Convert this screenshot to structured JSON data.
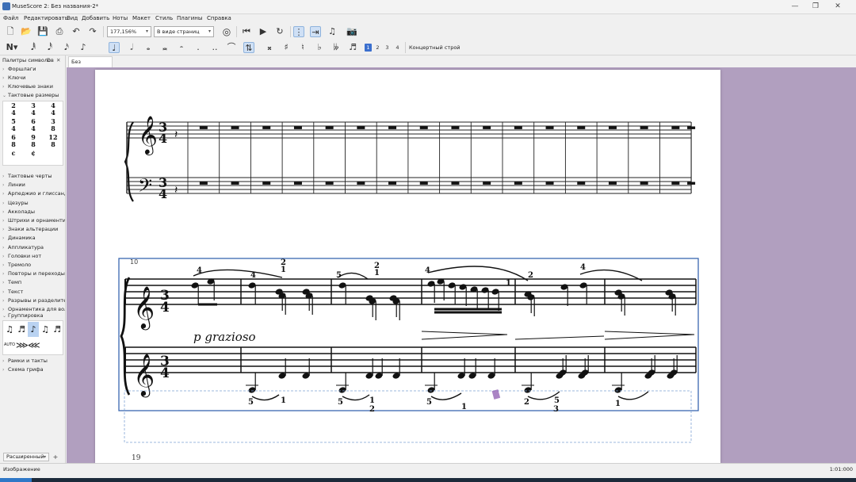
{
  "window": {
    "title": "MuseScore 2: Без названия-2*"
  },
  "menu": [
    "Файл",
    "Редактировать",
    "Вид",
    "Добавить",
    "Ноты",
    "Макет",
    "Стиль",
    "Плагины",
    "Справка"
  ],
  "toolbar": {
    "zoom": "177,156%",
    "view_mode": "В виде страниц"
  },
  "note_input": {
    "durations": [
      "♩",
      "♪"
    ],
    "voices": [
      "1",
      "2",
      "3",
      "4"
    ],
    "active_voice": "1",
    "concert_pitch": "Концертный строй"
  },
  "palette": {
    "title": "Палитры символов",
    "items_top": [
      {
        "label": "Форшлаги",
        "expanded": false
      },
      {
        "label": "Ключи",
        "expanded": false
      },
      {
        "label": "Ключевые знаки",
        "expanded": false
      },
      {
        "label": "Тактовые размеры",
        "expanded": true
      }
    ],
    "time_signatures": [
      [
        "2",
        "4"
      ],
      [
        "3",
        "4"
      ],
      [
        "4",
        "4"
      ],
      [
        "5",
        "4"
      ],
      [
        "6",
        "4"
      ],
      [
        "3",
        "8"
      ],
      [
        "6",
        "8"
      ],
      [
        "9",
        "8"
      ],
      [
        "12",
        "8"
      ],
      [
        "c",
        ""
      ],
      [
        "¢",
        ""
      ]
    ],
    "items_mid": [
      "Тактовые черты",
      "Линии",
      "Арпеджио и глиссанди",
      "Цезуры",
      "Акколады",
      "Штрихи и орнаментик",
      "Знаки альтерации",
      "Динамика",
      "Аппликатура",
      "Головки нот",
      "Тремоло",
      "Повторы и переходы",
      "Темп",
      "Текст",
      "Разрывы и разделите",
      "Орнаментика для вол"
    ],
    "grouping_label": "Группировка",
    "grouping_auto": "AUTO",
    "items_bottom": [
      "Рамки и такты",
      "Схема грифа"
    ],
    "workspace": "Расширенный"
  },
  "tab": {
    "label": "Без названия-2*"
  },
  "score": {
    "time_signature": [
      "3",
      "4"
    ],
    "image_dynamic": "p grazioso",
    "image_measure_number": "10",
    "page_number": "19",
    "fingerings_upper": [
      "4",
      "4",
      "2",
      "1",
      "5",
      "2",
      "1",
      "4",
      "1",
      "2",
      "4"
    ],
    "fingerings_lower": [
      "5",
      "1",
      "5",
      "1",
      "2",
      "5",
      "1",
      "2",
      "5",
      "1",
      "3"
    ]
  },
  "status": {
    "message": "Изображение",
    "position": "1:01:000"
  }
}
